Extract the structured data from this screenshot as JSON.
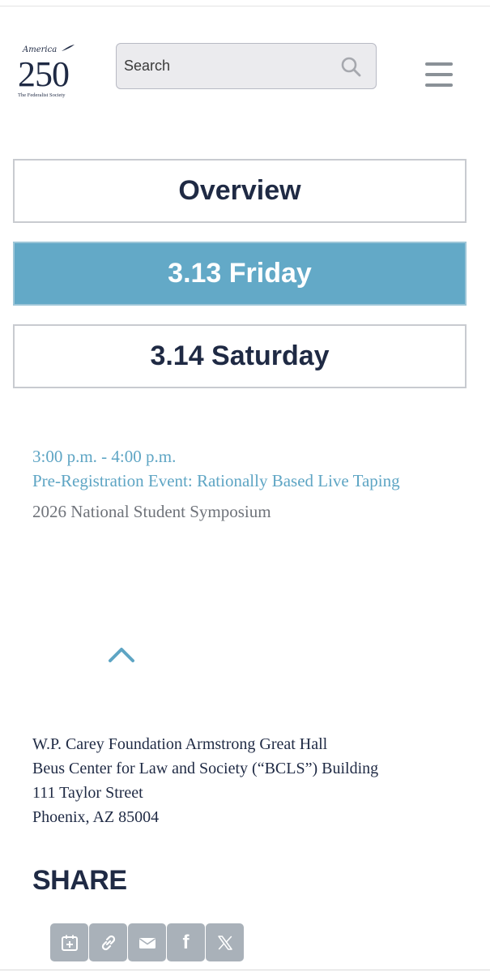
{
  "header": {
    "logo": {
      "script_text": "America",
      "number": "250",
      "subtitle": "The Federalist Society"
    },
    "search": {
      "placeholder": "Search"
    },
    "icons": {
      "search": "search-icon",
      "menu": "hamburger-menu-icon"
    }
  },
  "tabs": [
    {
      "label": "Overview",
      "active": false
    },
    {
      "label": "3.13 Friday",
      "active": true
    },
    {
      "label": "3.14 Saturday",
      "active": false
    }
  ],
  "event": {
    "time": "3:00 p.m. - 4:00 p.m.",
    "title": "Pre-Registration Event: Rationally Based Live Taping",
    "subtitle": "2026 National Student Symposium"
  },
  "address": {
    "line1": "W.P. Carey Foundation Armstrong Great Hall",
    "line2": "Beus Center for Law and Society (“BCLS”) Building",
    "line3": "111 Taylor Street",
    "line4": "Phoenix, AZ 85004"
  },
  "share": {
    "title": "SHARE",
    "buttons": [
      "calendar-add-icon",
      "link-icon",
      "email-icon",
      "facebook-icon",
      "x-icon"
    ]
  },
  "colors": {
    "navy": "#1f2a44",
    "accent_blue": "#63a9c7",
    "link_blue": "#5ea5c4",
    "gray_text": "#6f737a",
    "share_button_gray": "#a9b1b9"
  }
}
